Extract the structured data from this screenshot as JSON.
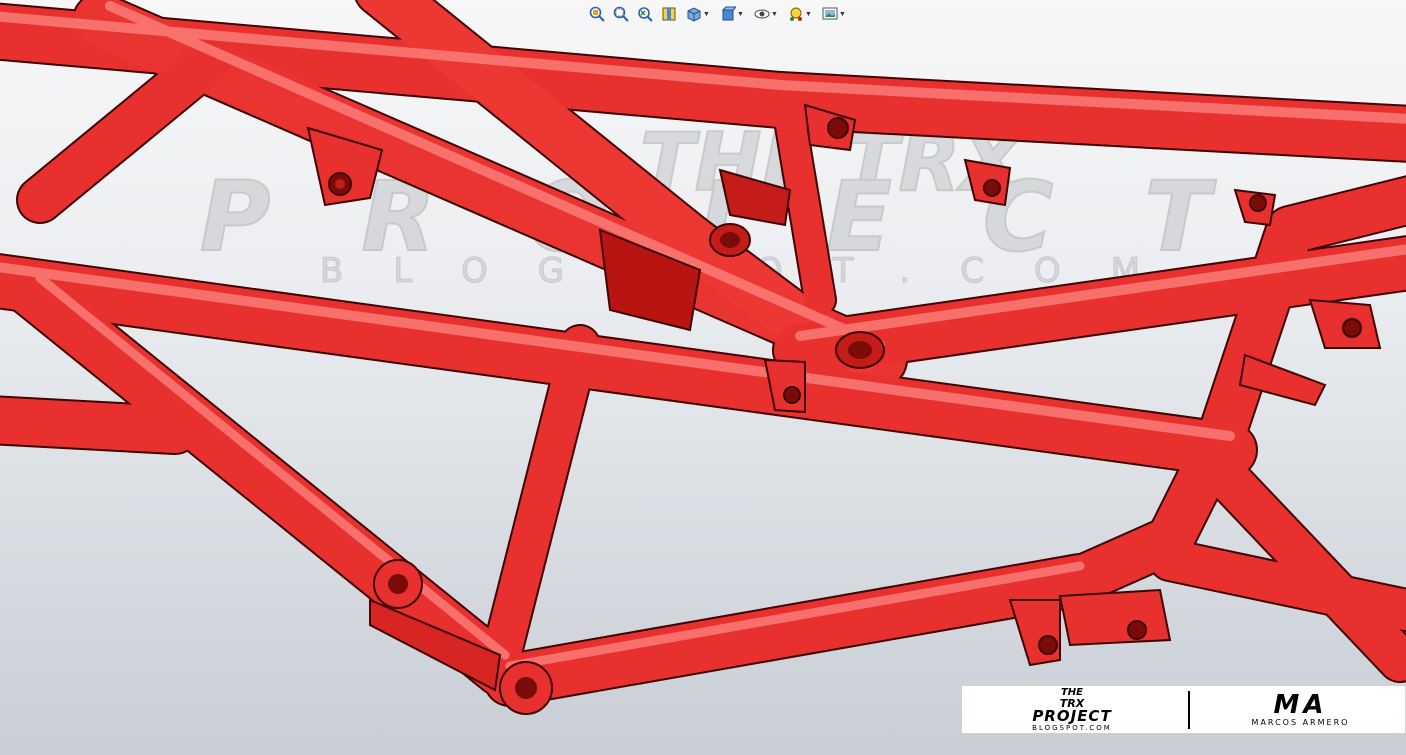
{
  "toolbar": {
    "items": [
      {
        "icon": "zoom-to-fit-icon",
        "dropdown": false
      },
      {
        "icon": "zoom-to-area-icon",
        "dropdown": false
      },
      {
        "icon": "previous-view-icon",
        "dropdown": false
      },
      {
        "icon": "section-view-icon",
        "dropdown": false
      },
      {
        "icon": "view-orientation-icon",
        "dropdown": true
      },
      {
        "icon": "display-style-icon",
        "dropdown": true
      },
      {
        "icon": "hide-show-items-icon",
        "dropdown": true
      },
      {
        "icon": "edit-appearance-icon",
        "dropdown": true
      },
      {
        "icon": "apply-scene-icon",
        "dropdown": true
      }
    ]
  },
  "model": {
    "color": "#e8312f"
  },
  "watermark": {
    "line1": "THE TRX",
    "line2": "PROJECT",
    "line3": "BLOGSPOT.COM"
  },
  "logo": {
    "left_line1": "THE",
    "left_line2": "TRX",
    "left_line3": "PROJECT",
    "left_line4": "BLOGSPOT.COM",
    "right_mark": "MA",
    "right_name": "MARCOS ARMERO"
  }
}
